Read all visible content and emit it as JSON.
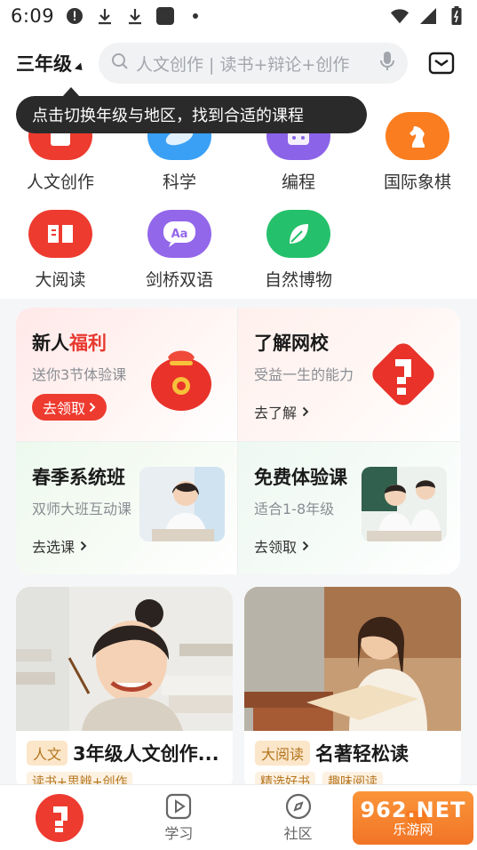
{
  "status_bar": {
    "time": "6:09"
  },
  "header": {
    "grade_label": "三年级",
    "search_placeholder": "人文创作 | 读书+辩论+创作"
  },
  "tooltip": {
    "text": "点击切换年级与地区，找到合适的课程"
  },
  "categories": [
    {
      "label": "人文创作",
      "color": "#ee3b2f",
      "icon": "book-icon"
    },
    {
      "label": "科学",
      "color": "#3aa0f5",
      "icon": "science-icon"
    },
    {
      "label": "编程",
      "color": "#8b63e8",
      "icon": "code-icon"
    },
    {
      "label": "国际象棋",
      "color": "#fa7d1f",
      "icon": "chess-knight-icon"
    },
    {
      "label": "大阅读",
      "color": "#ee3b2f",
      "icon": "open-book-icon"
    },
    {
      "label": "剑桥双语",
      "color": "#9267ea",
      "icon": "language-icon"
    },
    {
      "label": "自然博物",
      "color": "#25c06b",
      "icon": "leaf-icon"
    }
  ],
  "promos": {
    "newcomer": {
      "title_prefix": "新人",
      "title_accent": "福利",
      "subtitle": "送你3节体验课",
      "cta": "去领取"
    },
    "about": {
      "title": "了解网校",
      "subtitle": "受益一生的能力",
      "cta": "去了解"
    },
    "spring": {
      "title": "春季系统班",
      "subtitle": "双师大班互动课",
      "cta": "去选课"
    },
    "trial": {
      "title": "免费体验课",
      "subtitle": "适合1-8年级",
      "cta": "去领取"
    }
  },
  "courses": [
    {
      "tag": "人文",
      "title": "3年级人文创作...",
      "chips": [
        "读书+思辨+创作"
      ]
    },
    {
      "tag": "大阅读",
      "title": "名著轻松读",
      "chips": [
        "精选好书",
        "趣味阅读"
      ]
    }
  ],
  "bottom_nav": [
    {
      "label": "",
      "icon": "home-logo-icon"
    },
    {
      "label": "学习",
      "icon": "play-icon"
    },
    {
      "label": "社区",
      "icon": "compass-icon"
    }
  ],
  "watermark": {
    "big": "962.NET",
    "small": "乐游网"
  },
  "colors": {
    "accent_red": "#ee3b2f",
    "tooltip_bg": "#2a2a2a",
    "panel_bg": "#ffffff"
  }
}
